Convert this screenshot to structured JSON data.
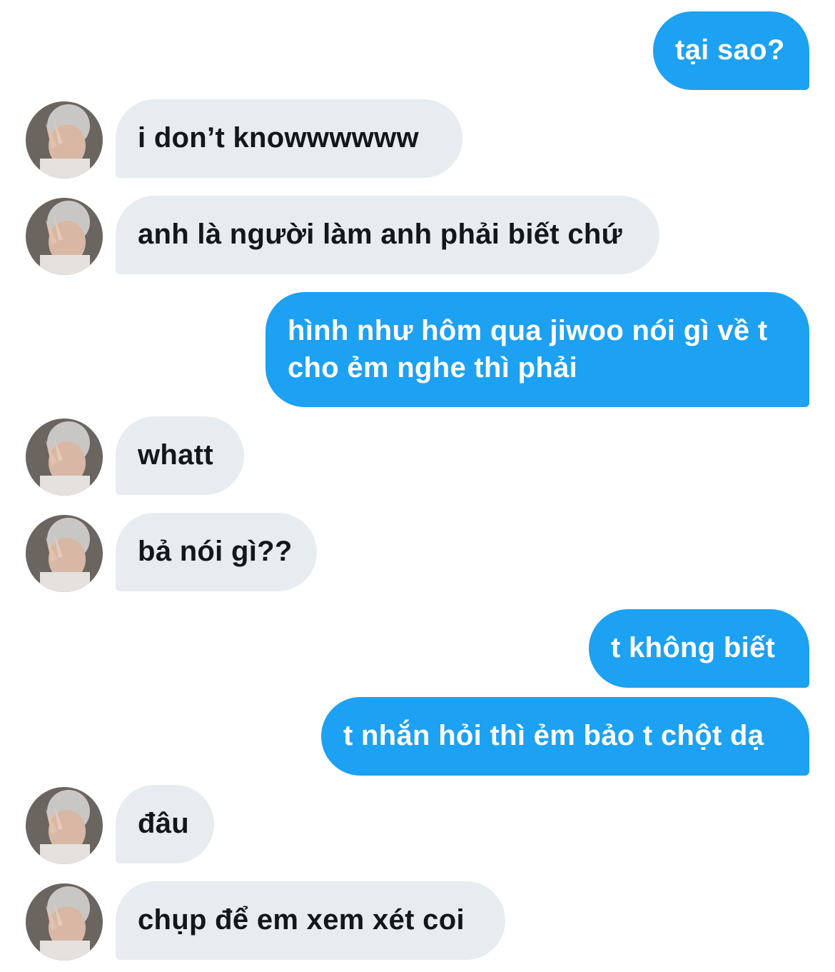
{
  "conversation": {
    "messages": [
      {
        "from": "me",
        "text": "tại sao?"
      },
      {
        "from": "other",
        "text": "i don’t knowwwwww"
      },
      {
        "from": "other",
        "text": "anh là người làm anh phải biết chứ"
      },
      {
        "from": "me",
        "text": "hình như hôm qua jiwoo nói gì về t\ncho ẻm nghe thì phải"
      },
      {
        "from": "other",
        "text": "whatt"
      },
      {
        "from": "other",
        "text": "bả nói gì??"
      },
      {
        "from": "me",
        "text": "t không biết"
      },
      {
        "from": "me",
        "text": "t nhắn hỏi thì ẻm bảo t chột dạ"
      },
      {
        "from": "other",
        "text": "đâu"
      },
      {
        "from": "other",
        "text": "chụp để em xem xét coi"
      }
    ]
  },
  "colors": {
    "sent_bubble": "#1da1f2",
    "received_bubble": "#e6ecf0",
    "sent_text": "#ffffff",
    "received_text": "#14171a"
  }
}
